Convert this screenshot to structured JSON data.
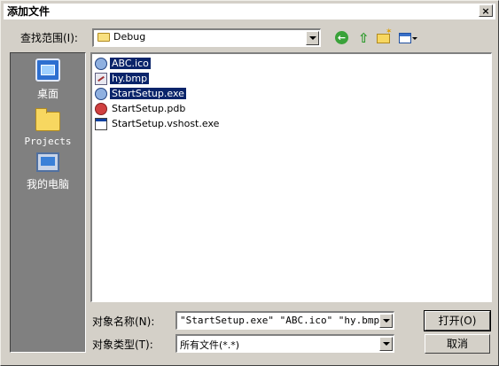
{
  "dialog": {
    "title": "添加文件",
    "close_glyph": "×"
  },
  "lookin": {
    "label": "查找范围(I):",
    "value": "Debug",
    "icon": "folder-icon"
  },
  "toolbar": {
    "back_glyph": "←",
    "up_glyph": "⇧",
    "newfolder_glyph": "✶"
  },
  "places": [
    {
      "label": "桌面",
      "icon": "desktop-icon"
    },
    {
      "label": "Projects",
      "icon": "folder-icon"
    },
    {
      "label": "我的电脑",
      "icon": "computer-icon"
    }
  ],
  "files": [
    {
      "name": "ABC.ico",
      "icon": "globe-file-icon",
      "selected": true
    },
    {
      "name": "hy.bmp",
      "icon": "bitmap-file-icon",
      "selected": true
    },
    {
      "name": "StartSetup.exe",
      "icon": "globe-file-icon",
      "selected": true
    },
    {
      "name": "StartSetup.pdb",
      "icon": "pdb-file-icon",
      "selected": false
    },
    {
      "name": "StartSetup.vshost.exe",
      "icon": "window-file-icon",
      "selected": false
    }
  ],
  "filename": {
    "label": "对象名称(N):",
    "value": "\"StartSetup.exe\" \"ABC.ico\" \"hy.bmp\""
  },
  "filetype": {
    "label": "对象类型(T):",
    "value": "所有文件(*.*)"
  },
  "buttons": {
    "open": "打开(O)",
    "cancel": "取消"
  }
}
